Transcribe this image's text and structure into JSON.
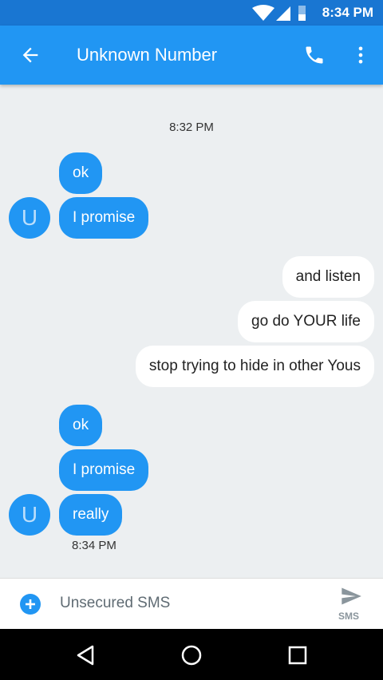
{
  "status_bar": {
    "time": "8:34 PM"
  },
  "app_bar": {
    "title": "Unknown Number"
  },
  "conversation": {
    "first_timestamp": "8:32 PM",
    "group1": {
      "avatar_letter": "U",
      "messages": [
        "ok",
        "I promise"
      ]
    },
    "sent": [
      "and listen",
      "go do YOUR life",
      "stop trying to hide in other Yous"
    ],
    "group2": {
      "avatar_letter": "U",
      "messages": [
        "ok",
        "I promise",
        "really"
      ],
      "timestamp": "8:34 PM"
    }
  },
  "compose": {
    "placeholder": "Unsecured SMS",
    "send_label": "SMS"
  },
  "colors": {
    "primary": "#2196f3",
    "primary_dark": "#1976d2",
    "incoming_bubble": "#2196f3",
    "outgoing_bubble": "#ffffff"
  }
}
